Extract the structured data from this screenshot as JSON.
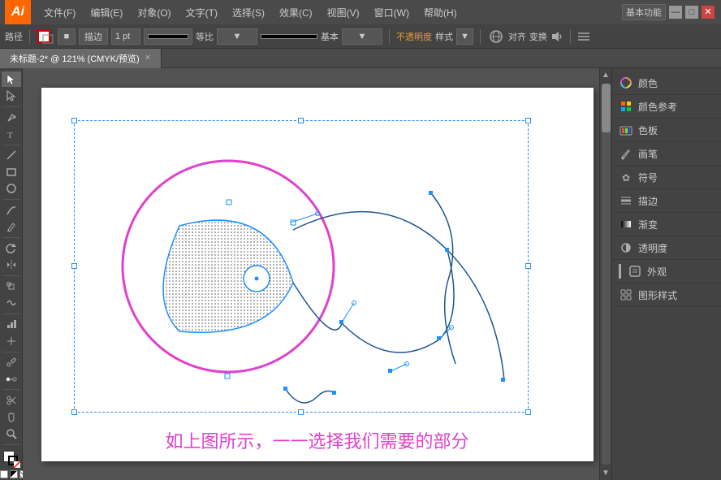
{
  "app": {
    "logo": "Ai",
    "title": "基本功能",
    "document_title": "未标题-2* @ 121% (CMYK/预览)",
    "zoom": "121%",
    "color_mode": "CMYK/预览"
  },
  "menu": {
    "items": [
      "文件(F)",
      "编辑(E)",
      "对象(O)",
      "文字(T)",
      "选择(S)",
      "效果(C)",
      "视图(V)",
      "窗口(W)",
      "帮助(H)"
    ]
  },
  "toolbar": {
    "type_label": "路径",
    "stroke_label": "描边",
    "stroke_width": "1 pt",
    "blend_label": "等比",
    "base_label": "基本",
    "opacity_label": "不透明度",
    "style_label": "样式",
    "align_label": "对齐",
    "transform_label": "变换"
  },
  "right_panel": {
    "items": [
      {
        "label": "颜色",
        "icon": "color-wheel"
      },
      {
        "label": "颜色参考",
        "icon": "color-ref"
      },
      {
        "label": "色板",
        "icon": "swatches"
      },
      {
        "label": "画笔",
        "icon": "brush"
      },
      {
        "label": "符号",
        "icon": "symbol"
      },
      {
        "label": "描边",
        "icon": "stroke"
      },
      {
        "label": "渐变",
        "icon": "gradient"
      },
      {
        "label": "透明度",
        "icon": "opacity"
      },
      {
        "label": "外观",
        "icon": "appearance"
      },
      {
        "label": "图形样式",
        "icon": "graphic-style"
      }
    ]
  },
  "caption": "如上图所示，一一选择我们需要的部分",
  "window_controls": {
    "minimize": "—",
    "maximize": "□",
    "close": "✕"
  }
}
